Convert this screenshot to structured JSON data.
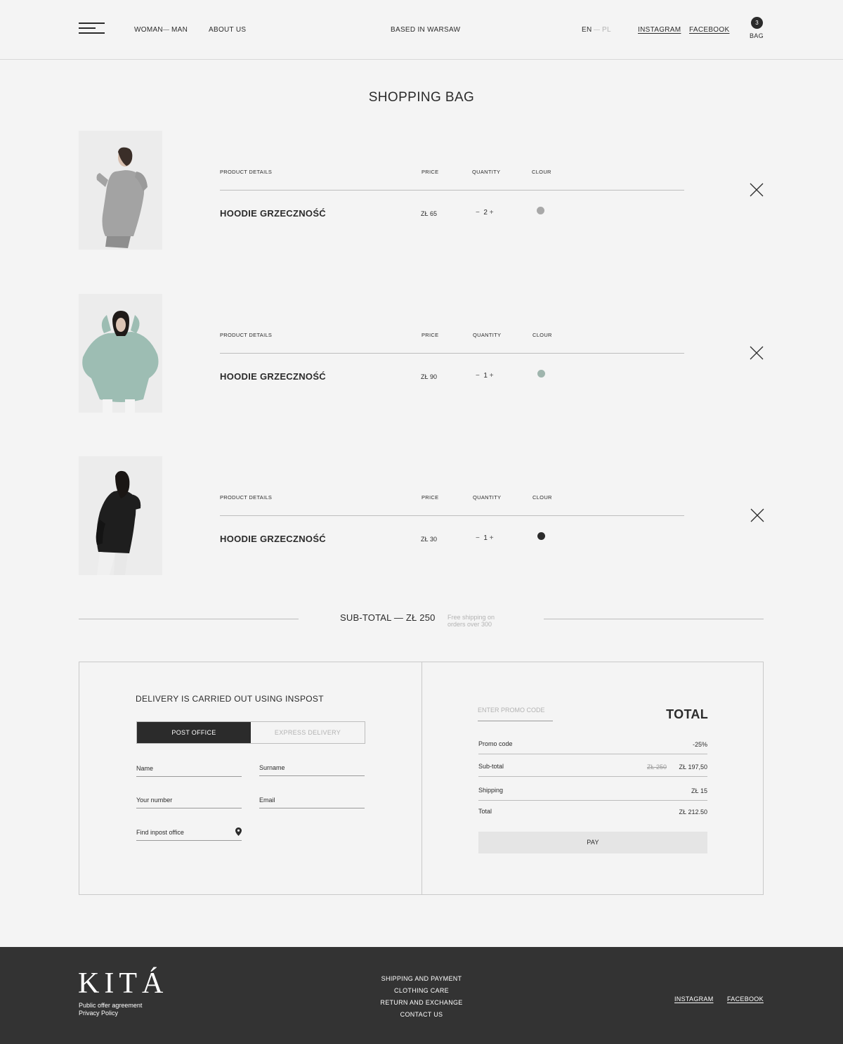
{
  "header": {
    "woman": "WOMAN",
    "man": "MAN",
    "about": "ABOUT US",
    "based": "BASED IN WARSAW",
    "lang_en": "EN",
    "lang_pl": "PL",
    "instagram": "INSTAGRAM",
    "facebook": "FACEBOOK",
    "bag_count": "3",
    "bag_label": "BAG"
  },
  "page_title": "SHOPPING BAG",
  "columns": {
    "details": "PRODUCT DETAILS",
    "price": "PRICE",
    "quantity": "QUANTITY",
    "colour": "CLOUR"
  },
  "items": [
    {
      "name": "HOODIE GRZECZNOŚĆ",
      "price": "ZŁ 65",
      "qty": "2",
      "colour_hex": "#a8a8a8",
      "garment_hex": "#9a9a9a"
    },
    {
      "name": "HOODIE GRZECZNOŚĆ",
      "price": "ZŁ 90",
      "qty": "1",
      "colour_hex": "#9fb5ad",
      "garment_hex": "#9dbdb3"
    },
    {
      "name": "HOODIE GRZECZNOŚĆ",
      "price": "ZŁ 30",
      "qty": "1",
      "colour_hex": "#2b2b2b",
      "garment_hex": "#222222"
    }
  ],
  "subtotal": {
    "label": "SUB-TOTAL — ZŁ 250",
    "note": "Free shipping on orders over 300"
  },
  "delivery": {
    "title": "DELIVERY IS CARRIED OUT USING INSPOST",
    "tab_post": "POST OFFICE",
    "tab_express": "EXPRESS DELIVERY",
    "name": "Name",
    "surname": "Surname",
    "number": "Your number",
    "email": "Email",
    "find_office": "Find inpost office"
  },
  "summary": {
    "promo_placeholder": "ENTER PROMO CODE",
    "title": "TOTAL",
    "promo_label": "Promo code",
    "promo_value": "-25%",
    "subtotal_label": "Sub-total",
    "subtotal_old": "ZŁ 250",
    "subtotal_value": "ZŁ 197,50",
    "shipping_label": "Shipping",
    "shipping_value": "ZŁ 15",
    "total_label": "Total",
    "total_value": "ZŁ 212.50",
    "pay": "PAY"
  },
  "footer": {
    "logo": "KITÁ",
    "offer": "Public offer agreement",
    "privacy": "Privacy Policy",
    "links": [
      "SHIPPING AND PAYMENT",
      "CLOTHING CARE",
      "RETURN AND EXCHANGE",
      "CONTACT US"
    ],
    "instagram": "INSTAGRAM",
    "facebook": "FACEBOOK"
  },
  "colors": {
    "background": "#f4f4f4",
    "text": "#2b2b2b",
    "footer": "#333333"
  }
}
